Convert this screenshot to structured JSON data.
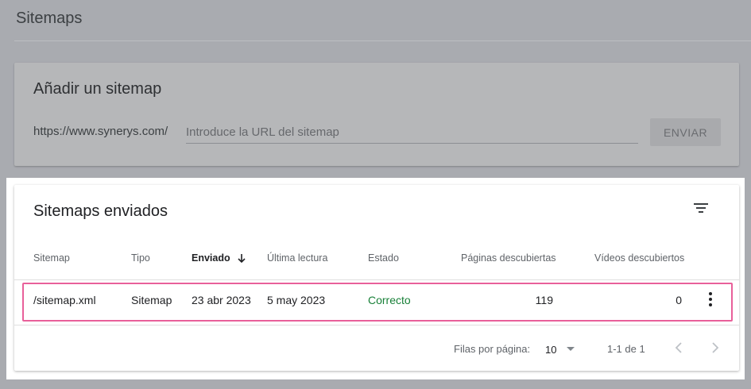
{
  "page": {
    "title": "Sitemaps"
  },
  "add_sitemap": {
    "title": "Añadir un sitemap",
    "url_prefix": "https://www.synerys.com/",
    "input_value": "",
    "input_placeholder": "Introduce la URL del sitemap",
    "submit_label": "ENVIAR"
  },
  "submitted": {
    "title": "Sitemaps enviados",
    "filter_icon": "filter-list-icon",
    "columns": {
      "sitemap": "Sitemap",
      "type": "Tipo",
      "submitted": "Enviado",
      "last_read": "Última lectura",
      "status": "Estado",
      "pages": "Páginas descubiertas",
      "videos": "Vídeos descubiertos"
    },
    "sort": {
      "column": "submitted",
      "direction": "descending"
    },
    "rows": [
      {
        "sitemap": "/sitemap.xml",
        "type": "Sitemap",
        "submitted": "23 abr 2023",
        "last_read": "5 may 2023",
        "status": "Correcto",
        "pages": "119",
        "videos": "0"
      }
    ],
    "footer": {
      "rows_per_page_label": "Filas por página:",
      "rows_per_page_value": "10",
      "range_label": "1-1 de 1"
    }
  },
  "colors": {
    "status_ok": "#188038",
    "highlight_border": "#e8609a",
    "overlay_background": "#a9abb0"
  }
}
